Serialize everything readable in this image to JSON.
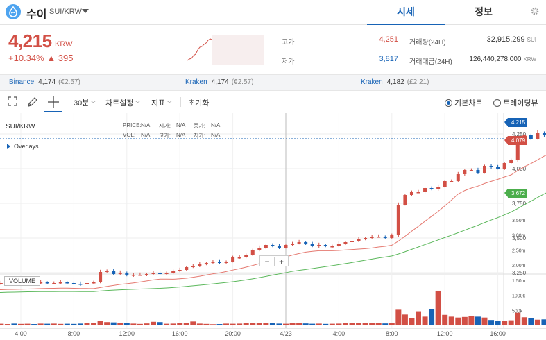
{
  "header": {
    "coin_name": "수이",
    "pair": "SUI/KRW",
    "tabs": [
      {
        "label": "시세",
        "active": true
      },
      {
        "label": "정보",
        "active": false
      }
    ]
  },
  "summary": {
    "price": "4,215",
    "unit": "KRW",
    "change_pct": "+10.34%",
    "change_abs": "▲ 395",
    "high_label": "고가",
    "high_value": "4,251",
    "low_label": "저가",
    "low_value": "3,817",
    "volume_label": "거래량(24H)",
    "volume_value": "32,915,299",
    "volume_unit": "SUI",
    "amount_label": "거래대금(24H)",
    "amount_value": "126,440,278,000",
    "amount_unit": "KRW"
  },
  "exchanges": [
    {
      "name": "Binance",
      "price": "4,174",
      "sub": "(€2.57)"
    },
    {
      "name": "Kraken",
      "price": "4,174",
      "sub": "(€2.57)"
    },
    {
      "name": "Kraken",
      "price": "4,182",
      "sub": "(£2.21)"
    }
  ],
  "toolbar": {
    "interval": "30분",
    "chart_settings": "차트설정",
    "indicators": "지표",
    "reset": "초기화",
    "basic_chart": "기본차트",
    "tradingview": "트레이딩뷰"
  },
  "chart_meta": {
    "symbol": "SUI/KRW",
    "overlays": "Overlays",
    "volume_label": "VOLUME",
    "zoom_out": "−",
    "zoom_in": "+",
    "ohlc": {
      "price_label": "PRICE:",
      "price": "N/A",
      "open_label": "시가:",
      "open": "N/A",
      "close_label": "종가:",
      "close": "N/A",
      "vol_label": "VOL:",
      "vol": "N/A",
      "high_label": "고가:",
      "high": "N/A",
      "low_label": "저가:",
      "low": "N/A"
    },
    "tags": {
      "last": "4,215",
      "ma_red": "4,079",
      "ma_green": "3,672"
    }
  },
  "colors": {
    "up": "#d24f45",
    "down": "#1763b6",
    "ma_red": "#e57a71",
    "ma_green": "#5cb85c",
    "accent": "#1763b6"
  },
  "chart_data": {
    "type": "candlestick",
    "price_axis_ticks": [
      "4,250",
      "4,000",
      "3,750",
      "3,500",
      "3,250"
    ],
    "volume_axis_ticks": [
      "3.50m",
      "3.00m",
      "2.50m",
      "2.00m",
      "1.50m",
      "1000k",
      "500k"
    ],
    "x_labels": [
      {
        "t": 4,
        "label": "4:00"
      },
      {
        "t": 8,
        "label": "8:00"
      },
      {
        "t": 12,
        "label": "12:00"
      },
      {
        "t": 16,
        "label": "16:00"
      },
      {
        "t": 20,
        "label": "20:00"
      },
      {
        "t": 24,
        "label": "4/23"
      },
      {
        "t": 28,
        "label": "4:00"
      },
      {
        "t": 32,
        "label": "8:00"
      },
      {
        "t": 36,
        "label": "12:00"
      },
      {
        "t": 40,
        "label": "16:00"
      }
    ],
    "t_start": 0,
    "t_step": 0.5,
    "closes": [
      3165,
      3165,
      3160,
      3170,
      3170,
      3175,
      3180,
      3175,
      3180,
      3185,
      3180,
      3180,
      3175,
      3175,
      3180,
      3175,
      3170,
      3165,
      3175,
      3180,
      3255,
      3265,
      3240,
      3250,
      3230,
      3235,
      3235,
      3240,
      3250,
      3240,
      3250,
      3260,
      3270,
      3290,
      3300,
      3310,
      3320,
      3330,
      3320,
      3330,
      3360,
      3360,
      3380,
      3410,
      3430,
      3450,
      3440,
      3430,
      3450,
      3460,
      3470,
      3460,
      3440,
      3450,
      3440,
      3440,
      3460,
      3470,
      3480,
      3490,
      3500,
      3510,
      3510,
      3500,
      3520,
      3740,
      3810,
      3830,
      3830,
      3860,
      3850,
      3870,
      3910,
      3910,
      3960,
      3990,
      3990,
      3970,
      4020,
      4010,
      4000,
      4040,
      4060,
      4220,
      4240,
      4215,
      4260,
      4240,
      4210,
      4230,
      4215
    ],
    "volumes": [
      40,
      45,
      40,
      50,
      40,
      55,
      45,
      60,
      50,
      55,
      45,
      60,
      55,
      60,
      50,
      55,
      50,
      60,
      70,
      75,
      150,
      110,
      100,
      90,
      80,
      60,
      50,
      65,
      120,
      110,
      55,
      60,
      80,
      75,
      130,
      60,
      50,
      40,
      45,
      60,
      55,
      60,
      70,
      80,
      90,
      85,
      75,
      60,
      55,
      70,
      80,
      65,
      55,
      60,
      50,
      55,
      60,
      75,
      70,
      80,
      85,
      90,
      70,
      65,
      80,
      520,
      360,
      240,
      470,
      290,
      550,
      1150,
      350,
      290,
      260,
      280,
      310,
      290,
      260,
      180,
      150,
      160,
      170,
      420,
      270,
      230,
      190,
      200,
      140,
      110,
      90
    ]
  }
}
